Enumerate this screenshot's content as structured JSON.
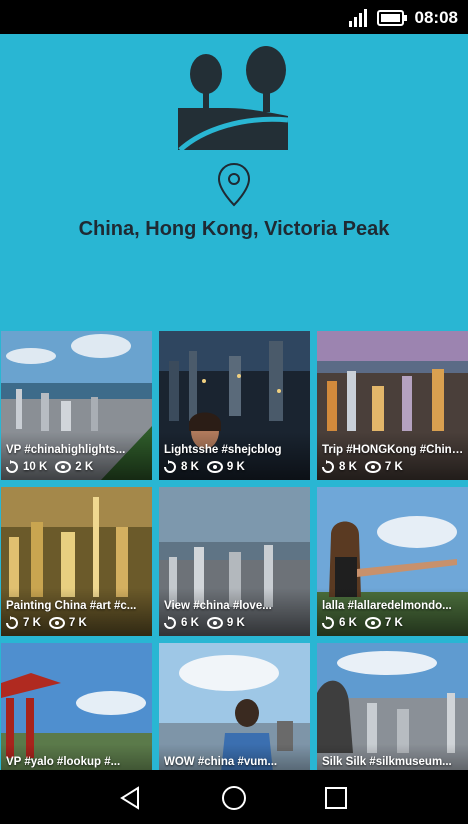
{
  "status_bar": {
    "time": "08:08",
    "icons": [
      "signal-icon",
      "battery-icon"
    ]
  },
  "hero": {
    "icon": "landscape-trees-icon",
    "pin_icon": "location-pin-icon",
    "place": "China, Hong Kong, Victoria Peak"
  },
  "grid": {
    "tiles": [
      {
        "caption": "VP #chinahighlights...",
        "reposts": "10 K",
        "views": "2 K"
      },
      {
        "caption": "Lightsshe #shejcblog",
        "reposts": "8 K",
        "views": "9 K"
      },
      {
        "caption": "Trip #HONGKong #China...",
        "reposts": "8 K",
        "views": "7 K"
      },
      {
        "caption": "Painting China #art #c...",
        "reposts": "7 K",
        "views": "7 K"
      },
      {
        "caption": "View #china #love...",
        "reposts": "6 K",
        "views": "9 K"
      },
      {
        "caption": "lalla #lallaredelmondo...",
        "reposts": "6 K",
        "views": "7 K"
      },
      {
        "caption": "VP #yalo #lookup #...",
        "reposts": "",
        "views": ""
      },
      {
        "caption": "WOW #china #vum...",
        "reposts": "",
        "views": ""
      },
      {
        "caption": "Silk Silk #silkmuseum...",
        "reposts": "",
        "views": ""
      }
    ]
  },
  "nav_bar": {
    "icons": [
      "back-icon",
      "home-icon",
      "recents-icon"
    ]
  },
  "colors": {
    "accent": "#29b6d3",
    "dark_text": "#1f2a33"
  }
}
